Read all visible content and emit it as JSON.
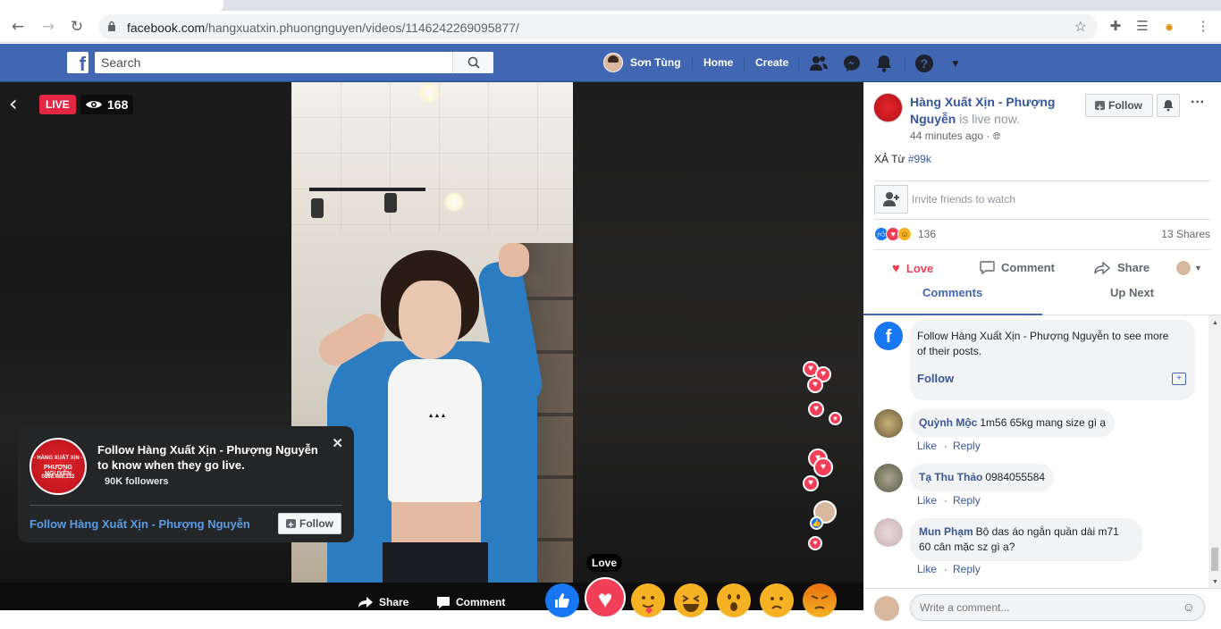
{
  "browser": {
    "url_host": "facebook.com",
    "url_path": "/hangxuatxin.phuongnguyen/videos/1146242269095877/"
  },
  "fb_nav": {
    "search_placeholder": "Search",
    "user_name": "Sơn Tùng",
    "home": "Home",
    "create": "Create"
  },
  "video": {
    "live_badge": "LIVE",
    "viewers": "168",
    "reaction_tooltip": "Love",
    "share": "Share",
    "comment": "Comment"
  },
  "follow_card": {
    "logo_text_1": "- HÀNG XUẤT XỊN -",
    "logo_text_2": "PHƯỢNG NGUYỄN",
    "logo_text_3": "0868.488.332",
    "title": "Follow Hàng Xuất Xịn - Phượng Nguyễn to know when they go live.",
    "followers": "90K followers",
    "link": "Follow Hàng Xuất Xịn - Phượng Nguyễn",
    "button": "Follow"
  },
  "panel": {
    "page_name": "Hàng Xuất Xịn - Phượng Nguyễn",
    "status": "is live now.",
    "time": "44 minutes ago ·",
    "follow_button": "Follow",
    "desc_prefix": "XẢ Từ ",
    "desc_tag": "#99k",
    "invite": "Invite friends to watch",
    "reaction_count": "136",
    "shares": "13 Shares",
    "love": "Love",
    "comment": "Comment",
    "share": "Share",
    "tab_comments": "Comments",
    "tab_upnext": "Up Next",
    "follow_prompt": "Follow Hàng Xuất Xịn - Phượng Nguyễn to see more of their posts.",
    "follow_prompt_link": "Follow",
    "comments": [
      {
        "name": "Quỳnh Mộc",
        "text": "1m56 65kg mang size gì ạ",
        "like": "Like",
        "reply": "Reply"
      },
      {
        "name": "Tạ Thu Thảo",
        "text": "0984055584",
        "like": "Like",
        "reply": "Reply"
      },
      {
        "name": "Mun Phạm",
        "text": "Bộ das áo ngắn quần dài m71 60 cân mặc sz gì ạ?",
        "like": "Like",
        "reply": "Reply"
      }
    ],
    "write_placeholder": "Write a comment..."
  },
  "colors": {
    "fb_blue": "#4267b2",
    "live_red": "#e42645",
    "love_red": "#f33e58",
    "link_blue": "#365899"
  }
}
